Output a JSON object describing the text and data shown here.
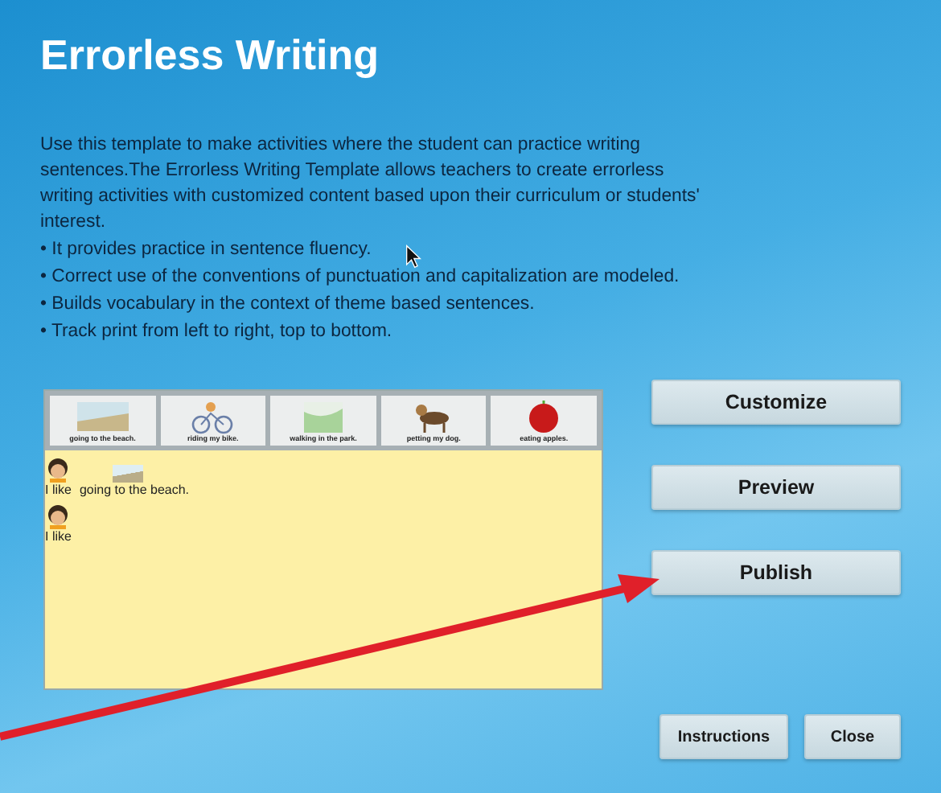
{
  "title": "Errorless Writing",
  "intro": "Use this template to make activities where the student can practice writing sentences.The Errorless Writing Template allows teachers to create errorless writing activities with customized content based upon their curriculum or students' interest.",
  "bullets": [
    "• It provides practice in sentence fluency.",
    "• Correct use of the conventions of punctuation and capitalization are modeled.",
    "• Builds vocabulary in the context of theme based sentences.",
    "• Track print from left to right, top to bottom."
  ],
  "preview": {
    "cards": [
      {
        "kind": "beach",
        "caption": "going to the beach."
      },
      {
        "kind": "bike",
        "caption": "riding my bike."
      },
      {
        "kind": "park",
        "caption": "walking in the park."
      },
      {
        "kind": "dog",
        "caption": "petting my dog."
      },
      {
        "kind": "apple",
        "caption": "eating apples."
      }
    ],
    "sentences": [
      {
        "parts": [
          "I like",
          "going to the beach."
        ]
      },
      {
        "parts": [
          "I like"
        ]
      }
    ]
  },
  "main_buttons": [
    "Customize",
    "Preview",
    "Publish"
  ],
  "footer_buttons": [
    "Instructions",
    "Close"
  ]
}
